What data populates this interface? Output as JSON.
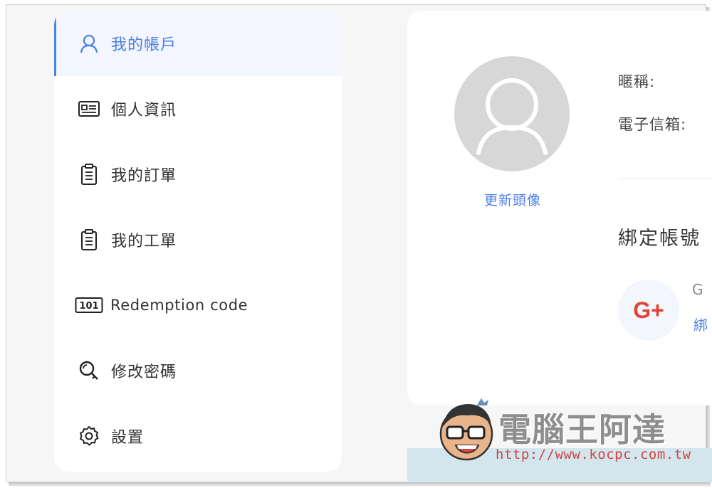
{
  "sidebar": {
    "items": [
      {
        "label": "我的帳戶",
        "icon": "user-icon",
        "active": true
      },
      {
        "label": "個人資訊",
        "icon": "id-card-icon",
        "active": false
      },
      {
        "label": "我的訂單",
        "icon": "clipboard-icon",
        "active": false
      },
      {
        "label": "我的工單",
        "icon": "clipboard-icon",
        "active": false
      },
      {
        "label": "Redemption code",
        "icon": "code-101-icon",
        "active": false
      },
      {
        "label": "修改密碼",
        "icon": "key-search-icon",
        "active": false
      },
      {
        "label": "設置",
        "icon": "gear-icon",
        "active": false
      }
    ],
    "code_icon_text": "101"
  },
  "profile": {
    "update_avatar_label": "更新頭像",
    "nickname_label": "暱稱:",
    "email_label": "電子信箱:",
    "bind_title": "綁定帳號",
    "google_icon_text": "G+",
    "google_partial_label": "G",
    "google_partial_link": "綁"
  },
  "watermark": {
    "title": "電腦王阿達",
    "url": "http://www.kocpc.com.tw"
  },
  "colors": {
    "accent": "#4a7fe6",
    "background": "#f6f6f7",
    "google_red": "#e0433a"
  }
}
